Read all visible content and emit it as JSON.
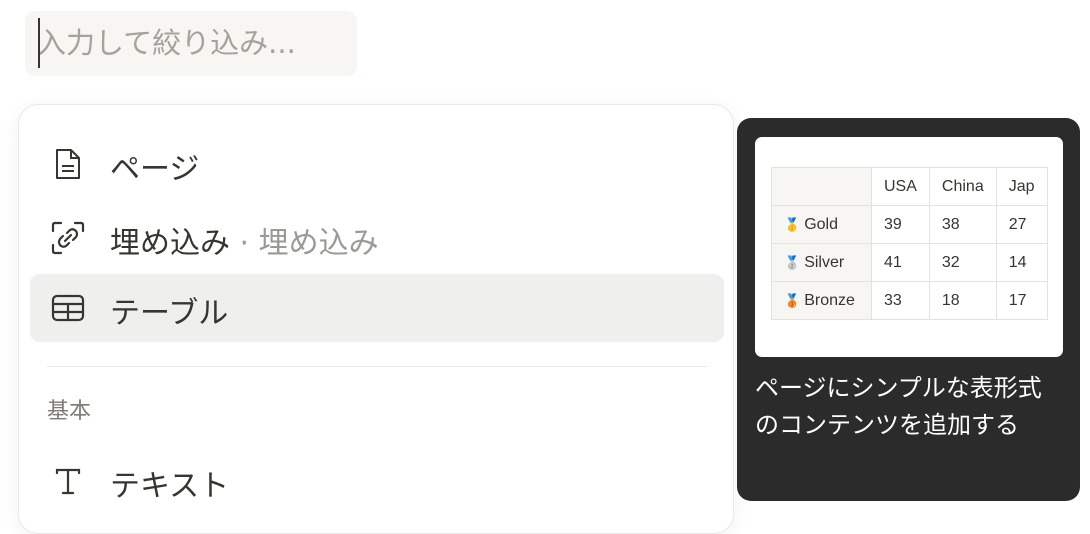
{
  "filter": {
    "placeholder": "入力して絞り込み..."
  },
  "menu": {
    "items": [
      {
        "label": "ページ",
        "icon": "page-icon"
      },
      {
        "label": "埋め込み",
        "sub": "· 埋め込み",
        "icon": "embed-link-icon"
      },
      {
        "label": "テーブル",
        "icon": "table-icon"
      }
    ],
    "section_basic": "基本",
    "basic_items": [
      {
        "label": "テキスト",
        "icon": "text-icon"
      }
    ]
  },
  "preview": {
    "table": {
      "headers": [
        "USA",
        "China",
        "Jap"
      ],
      "rows": [
        {
          "medal": "🥇",
          "name": "Gold",
          "values": [
            "39",
            "38",
            "27"
          ]
        },
        {
          "medal": "🥈",
          "name": "Silver",
          "values": [
            "41",
            "32",
            "14"
          ]
        },
        {
          "medal": "🥉",
          "name": "Bronze",
          "values": [
            "33",
            "18",
            "17"
          ]
        }
      ]
    },
    "description": "ページにシンプルな表形式のコンテンツを追加する"
  },
  "colors": {
    "active_bg": "#efefed",
    "tooltip_bg": "#2b2b2b",
    "text": "#37352f"
  }
}
